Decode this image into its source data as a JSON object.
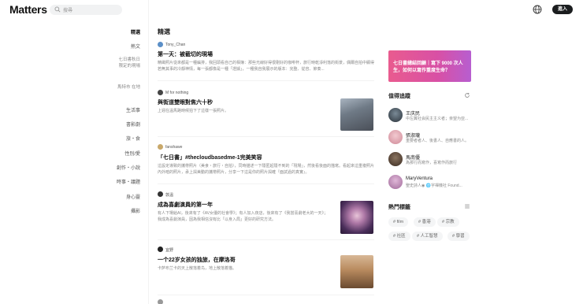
{
  "app": {
    "logo": "Matters"
  },
  "search": {
    "placeholder": "搜尋"
  },
  "header": {
    "login_label": "進入"
  },
  "nav": {
    "items": [
      {
        "label": "精選",
        "active": true
      },
      {
        "label": "熱文"
      },
      {
        "label": "七日書秋日限定的現場"
      },
      {
        "label": "馬特市 在地"
      },
      {
        "label": "生活事"
      },
      {
        "label": "書影劇"
      },
      {
        "label": "旅・食"
      },
      {
        "label": "性別/愛"
      },
      {
        "label": "創作・小說"
      },
      {
        "label": "時事・議題"
      },
      {
        "label": "身心靈"
      },
      {
        "label": "攝影"
      }
    ]
  },
  "feed": {
    "title": "精選",
    "posts": [
      {
        "author": "Tony_Chan",
        "title": "第一天：被截切的現場",
        "summary": "精緻照片從來都是一種編排，我回頭看自己的相簿：那些光線好得很剛好的咖啡杯，旅行時乾淨利落的街景，偶爾自拍中顯得若無其事的冷靜神情，每一張都像是一種「證據」，一種我自我展示的版本：完整、從容、節奏..."
      },
      {
        "author": "M for nothing",
        "title": "與街道雙眼對焦六十秒",
        "summary": "上週在溫馬路時候拍下了這樣一張照片。"
      },
      {
        "author": "fanshawe",
        "title": "「七日書」#thecloudbasedme-1完美笑容",
        "summary": "這設定導致的攜帶照片（美食・旅行・自拍），同時描述一下隱匿起隱不到的「現場」，然後看後面的描寫。看起來這重複照片內外暗的照片，承上與美動的攜帶照片，分享一下這是你的照片與確『面試過的真實』。"
      },
      {
        "author": "敦溫",
        "title": "成為喜劇演員的第一年",
        "summary": "有人下場給AI，後來有了《AV女優的社會學》；有人加入夜店，後來有了《我當喜劇老大的一天》；我成為喜劇演員，因為我相信沒有比「以身入局」更好的研究方法。"
      },
      {
        "author": "宜野",
        "title": "一个22岁女孩的独旅，在摩洛哥",
        "summary": "卡萨布兰卡的天上散落着鸟，地上散落着猫。"
      }
    ]
  },
  "right": {
    "banner_text": "七日書總結回顧｜寫下 9000 次人生，如何以寫作重度生命？",
    "follow_title": "值得追蹤",
    "users": [
      {
        "name": "王庆民",
        "desc": "中左翼社会民主主义者；亲望为亚..."
      },
      {
        "name": "張淑瓏",
        "desc": "重要者者人、後書人、自應書的人。"
      },
      {
        "name": "馬南優",
        "desc": "為那行而寫作，喜寫作而旅行"
      },
      {
        "name": "MaryVentura",
        "desc": "聖史詩人◉ 🌐字禪機社 Found..."
      }
    ],
    "tags_title": "熱門標籤",
    "tags": [
      "film",
      "香港",
      "宗教",
      "社區",
      "人工智慧",
      "學習"
    ]
  },
  "colors": {
    "accent": "#1b1d1f",
    "banner_start": "#e95b8f",
    "banner_end": "#b75ed0"
  },
  "icons": [
    "search-icon",
    "globe-icon",
    "refresh-icon",
    "hash-icon",
    "filter-icon"
  ]
}
